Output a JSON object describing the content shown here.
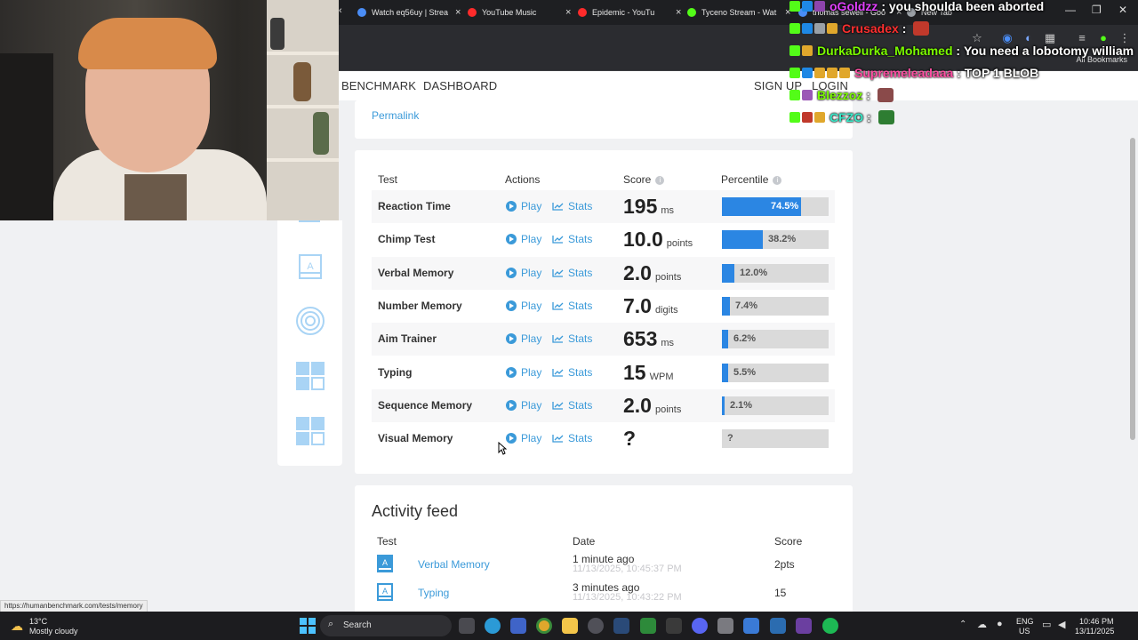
{
  "browser": {
    "tabs": [
      {
        "label": "Watch eq56uy | Strea",
        "color": "#4a8df6"
      },
      {
        "label": "YouTube Music",
        "color": "#ff2b2b"
      },
      {
        "label": "Epidemic - YouTu",
        "color": "#ff2b2b"
      },
      {
        "label": "Tyceno Stream - Wat",
        "color": "#53fc18"
      },
      {
        "label": "thomas sewell - Goo",
        "color": "#4a8df6"
      },
      {
        "label": "New Tab",
        "color": "#9aa0a6"
      }
    ],
    "bookmarks_label": "All Bookmarks"
  },
  "nav": {
    "brand": "BENCHMARK",
    "dashboard": "DASHBOARD",
    "signup": "SIGN UP",
    "login": "LOGIN"
  },
  "profile": {
    "permalink": "Permalink"
  },
  "table": {
    "headers": {
      "test": "Test",
      "actions": "Actions",
      "score": "Score",
      "percentile": "Percentile"
    },
    "play_label": "Play",
    "stats_label": "Stats",
    "rows": [
      {
        "name": "Reaction Time",
        "score": "195",
        "unit": "ms",
        "percentile_label": "74.5%",
        "percentile": 74.5
      },
      {
        "name": "Chimp Test",
        "score": "10.0",
        "unit": "points",
        "percentile_label": "38.2%",
        "percentile": 38.2
      },
      {
        "name": "Verbal Memory",
        "score": "2.0",
        "unit": "points",
        "percentile_label": "12.0%",
        "percentile": 12.0
      },
      {
        "name": "Number Memory",
        "score": "7.0",
        "unit": "digits",
        "percentile_label": "7.4%",
        "percentile": 7.4
      },
      {
        "name": "Aim Trainer",
        "score": "653",
        "unit": "ms",
        "percentile_label": "6.2%",
        "percentile": 6.2
      },
      {
        "name": "Typing",
        "score": "15",
        "unit": "WPM",
        "percentile_label": "5.5%",
        "percentile": 5.5
      },
      {
        "name": "Sequence Memory",
        "score": "2.0",
        "unit": "points",
        "percentile_label": "2.1%",
        "percentile": 2.1
      },
      {
        "name": "Visual Memory",
        "score": "?",
        "unit": "",
        "percentile_label": "?",
        "percentile": 0
      }
    ]
  },
  "feed": {
    "title": "Activity feed",
    "headers": {
      "test": "Test",
      "date": "Date",
      "score": "Score"
    },
    "items": [
      {
        "test": "Verbal Memory",
        "ago": "1 minute ago",
        "timestamp": "11/13/2025, 10:45:37 PM",
        "score": "2pts"
      },
      {
        "test": "Typing",
        "ago": "3 minutes ago",
        "timestamp": "11/13/2025, 10:43:22 PM",
        "score": "15"
      }
    ]
  },
  "chat": [
    {
      "name": "oGoldzz",
      "color": "#e040fb",
      "message": "you shoulda been aborted"
    },
    {
      "name": "Crusadex",
      "color": "#ff3030",
      "message": ""
    },
    {
      "name": "DurkaDurka_Mohamed",
      "color": "#7cfc00",
      "message": "You need a lobotomy william"
    },
    {
      "name": "Supremeleadaaa",
      "color": "#ff4fa3",
      "message": "TOP 1 BLOB"
    },
    {
      "name": "Blezzoz",
      "color": "#7cfc00",
      "message": ""
    },
    {
      "name": "CFZO",
      "color": "#38e8c8",
      "message": ""
    }
  ],
  "status_url": "https://humanbenchmark.com/tests/memory",
  "taskbar": {
    "weather_temp": "13°C",
    "weather_desc": "Mostly cloudy",
    "search_label": "Search",
    "lang": "ENG",
    "region": "US",
    "time": "10:46 PM",
    "date": "13/11/2025"
  }
}
